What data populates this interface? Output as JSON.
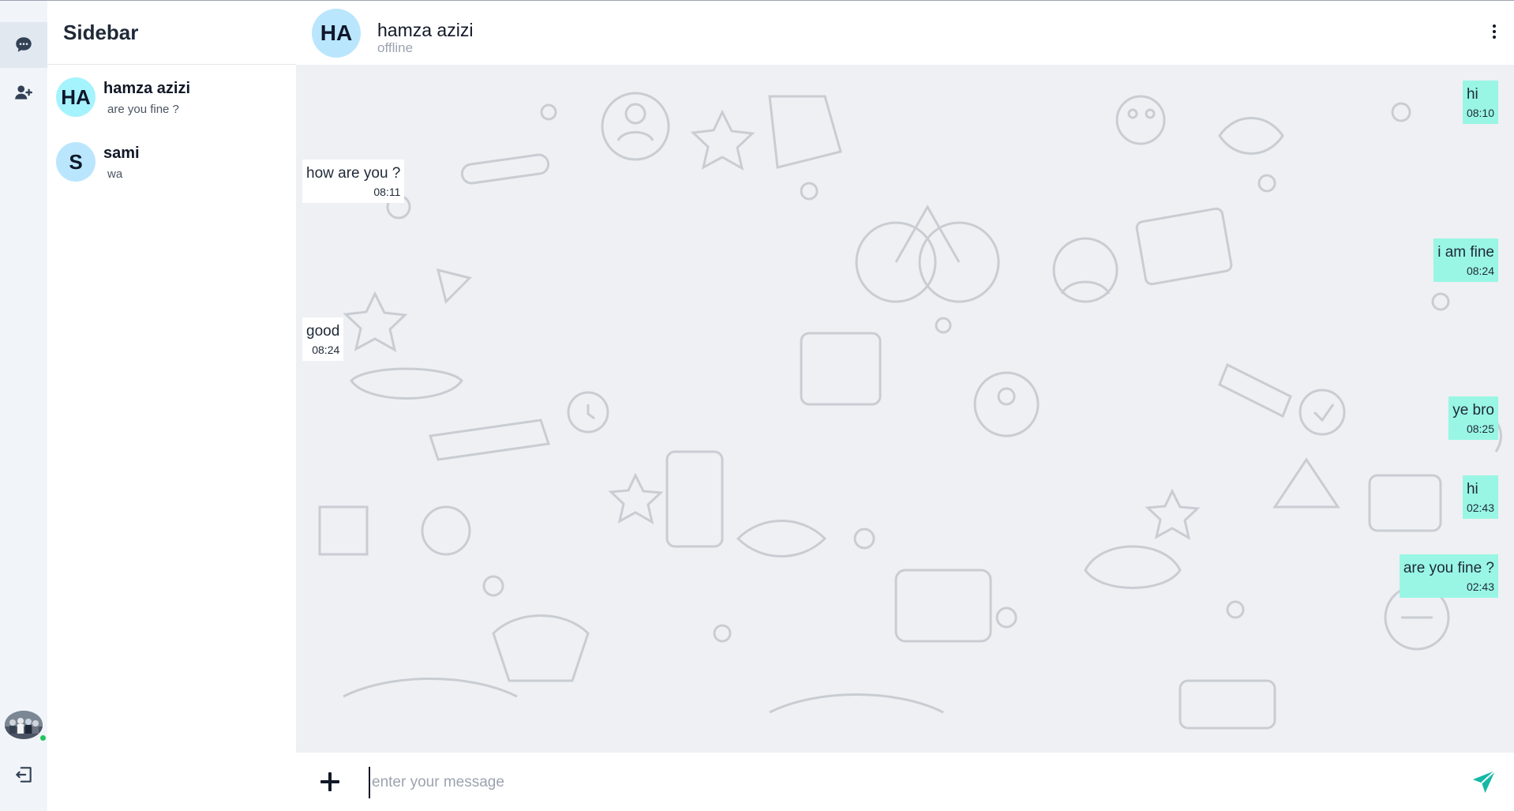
{
  "rail": {
    "icons": [
      "chat-bubble-icon",
      "add-user-icon",
      "logout-icon"
    ],
    "accent": "#e2e8f0",
    "status_color": "#22c55e"
  },
  "sidebar": {
    "title": "Sidebar",
    "conversations": [
      {
        "initials": "HA",
        "name": "hamza azizi",
        "preview": "are you fine ?",
        "avatar_color": "#a5f3fc"
      },
      {
        "initials": "S",
        "name": "sami",
        "preview": "wa",
        "avatar_color": "#bae6fd"
      }
    ]
  },
  "chat": {
    "initials": "HA",
    "name": "hamza azizi",
    "status": "offline",
    "messages": [
      {
        "direction": "out",
        "text": "hi",
        "time": "08:10"
      },
      {
        "direction": "in",
        "text": "how are you ?",
        "time": "08:11"
      },
      {
        "direction": "out",
        "text": "i am fine",
        "time": "08:24"
      },
      {
        "direction": "in",
        "text": "good",
        "time": "08:24"
      },
      {
        "direction": "out",
        "text": "ye bro",
        "time": "08:25"
      },
      {
        "direction": "out",
        "text": "hi",
        "time": "02:43"
      },
      {
        "direction": "out",
        "text": "are you fine ?",
        "time": "02:43"
      }
    ],
    "outgoing_color": "#99f6e4",
    "incoming_color": "#ffffff"
  },
  "composer": {
    "placeholder": "enter your message",
    "value": "",
    "send_color": "#14b8a6"
  }
}
